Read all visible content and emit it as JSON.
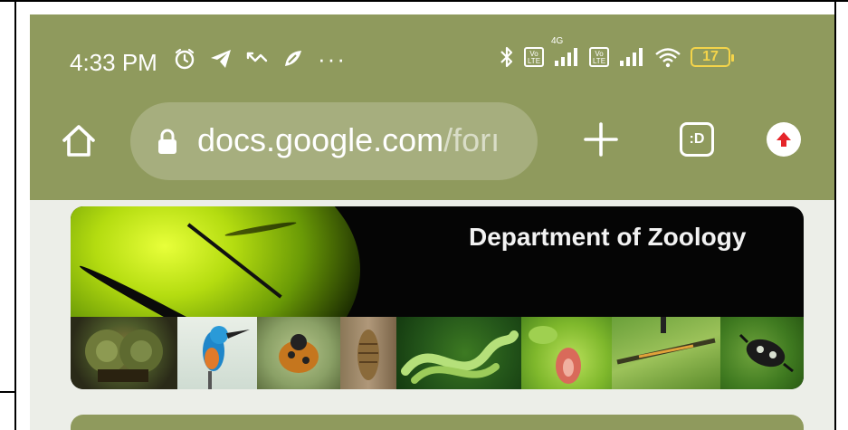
{
  "status_bar": {
    "time": "4:33 PM",
    "left_icons": [
      "alarm-icon",
      "telegram-icon",
      "missed-call-icon",
      "app-notification-icon",
      "more-dots-icon"
    ],
    "right_icons": [
      "bluetooth-icon",
      "volte-icon",
      "signal-4g-icon",
      "volte-icon",
      "signal-icon",
      "wifi-icon"
    ],
    "more_dots": "···",
    "network_type": "4G",
    "volte_label": "Vo\nLTE",
    "battery_level": "17",
    "battery_color": "#f4d44a"
  },
  "toolbar": {
    "url_domain": "docs.google.com",
    "url_path": "/forı",
    "tab_switcher_label": ":D",
    "toolbar_color": "#8f9a5d",
    "omnibox_color": "#a6ae7e",
    "update_badge_color": "#e5252a"
  },
  "banner": {
    "title": "Department of Zoology",
    "image_tiles": [
      "dragonfly-eyes",
      "kingfisher",
      "ladybug",
      "pupa",
      "green-snake",
      "flower-insect",
      "damselfly",
      "beetle"
    ]
  },
  "page": {
    "background_color": "#eceee8"
  }
}
